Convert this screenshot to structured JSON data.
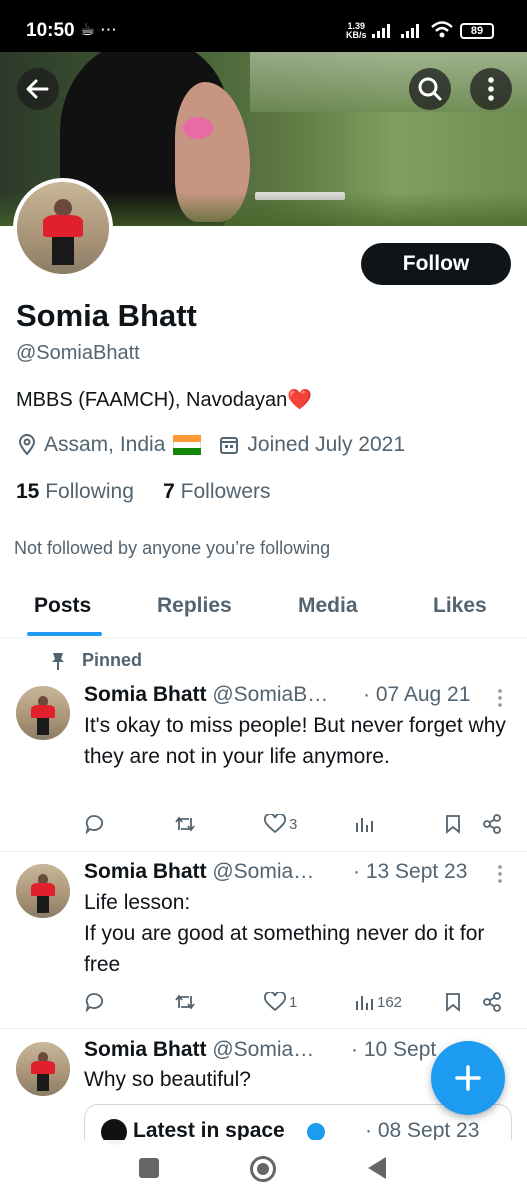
{
  "status_bar": {
    "time": "10:50",
    "net_speed_value": "1.39",
    "net_speed_unit": "KB/s",
    "battery": "89",
    "icons": [
      "tea-icon",
      "more-dots-icon",
      "signal-icon",
      "signal-icon",
      "wifi-icon",
      "battery-icon"
    ]
  },
  "profile": {
    "name": "Somia Bhatt",
    "handle": "@SomiaBhatt",
    "bio": "MBBS (FAAMCH), Navodayan",
    "bio_emoji": "❤️",
    "location": "Assam, India",
    "joined": "Joined July 2021",
    "following_count": "15",
    "following_label": "Following",
    "followers_count": "7",
    "followers_label": "Followers",
    "not_followed_note": "Not followed by anyone you’re following",
    "follow_button": "Follow"
  },
  "tabs": [
    {
      "label": "Posts",
      "active": true
    },
    {
      "label": "Replies"
    },
    {
      "label": "Media"
    },
    {
      "label": "Likes"
    }
  ],
  "pinned_label": "Pinned",
  "tweets": [
    {
      "name": "Somia Bhatt",
      "handle": "@SomiaB…",
      "date": "· 07 Aug 21",
      "text": "It's okay to miss people! But never forget why they are not in your life anymore.",
      "likes": "3",
      "views": ""
    },
    {
      "name": "Somia Bhatt",
      "handle": "@Somia…",
      "date": "· 13 Sept 23",
      "text_line1": "Life lesson:",
      "text_line2": "If you are good at something never do it for free",
      "likes": "1",
      "views": "162"
    },
    {
      "name": "Somia Bhatt",
      "handle": "@Somia…",
      "date": "· 10 Sept",
      "text": "Why so beautiful?",
      "quote": {
        "name": "Latest in space",
        "date": "· 08 Sept 23"
      }
    }
  ],
  "colors": {
    "accent": "#1d9bf0",
    "text_primary": "#0f1419",
    "text_secondary": "#536471",
    "heart": "#e0245e"
  }
}
